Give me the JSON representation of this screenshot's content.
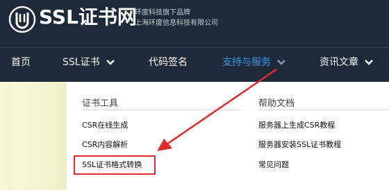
{
  "header": {
    "brand": "SSL证书网",
    "tagline_line1": "环度科技旗下品牌",
    "tagline_line2": "上海环度信息科技有限公司"
  },
  "nav": {
    "items": [
      {
        "label": "首页"
      },
      {
        "label": "SSL证书"
      },
      {
        "label": "代码签名"
      },
      {
        "label": "支持与服务"
      },
      {
        "label": "资讯文章"
      }
    ]
  },
  "dropdown": {
    "col1": {
      "title": "证书工具",
      "links": [
        "CSR在线生成",
        "CSR内容解析",
        "SSL证书格式转换"
      ]
    },
    "col2": {
      "title": "帮助文档",
      "links": [
        "服务器上生成CSR教程",
        "服务器安装SSL证书教程",
        "常见问题"
      ]
    }
  },
  "colors": {
    "header_bg": "#1e2a3a",
    "active_nav": "#2e9cf0",
    "annotation": "#e02b2b"
  }
}
